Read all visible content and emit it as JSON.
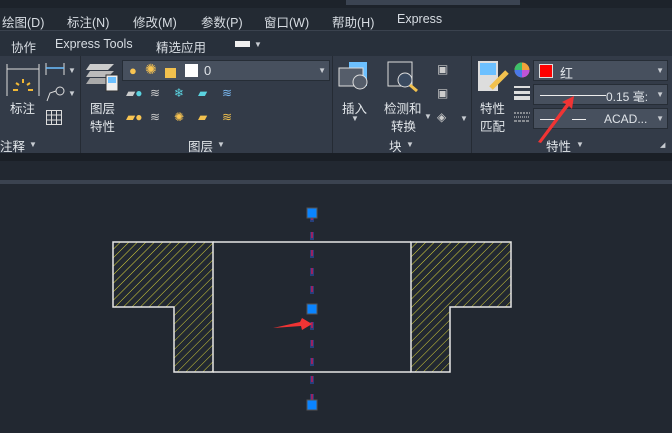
{
  "menubar": {
    "items": [
      "绘图(D)",
      "标注(N)",
      "修改(M)",
      "参数(P)",
      "窗口(W)",
      "帮助(H)",
      "Express"
    ]
  },
  "tabs": {
    "items": [
      "协作",
      "Express Tools",
      "精选应用"
    ]
  },
  "annotation_panel": {
    "dimension_label": "标注",
    "panel_label": "注释"
  },
  "layers_panel": {
    "layer_properties_label_1": "图层",
    "layer_properties_label_2": "特性",
    "current_layer": "0",
    "panel_label": "图层"
  },
  "block_panel": {
    "insert_label": "插入",
    "detect_label_1": "检测和",
    "detect_label_2": "转换",
    "panel_label": "块"
  },
  "properties_panel": {
    "match_label_1": "特性",
    "match_label_2": "匹配",
    "color_value": "红",
    "color_hex": "#ff0000",
    "lineweight_value": "0.15 毫:",
    "linetype_value": "ACAD...",
    "panel_label": "特性"
  },
  "colors": {
    "hatch": "#d8d23a",
    "outline": "#e6e6e6",
    "centerline": "#c0185a",
    "grip": "#0a84ff",
    "arrow": "#f03434"
  }
}
